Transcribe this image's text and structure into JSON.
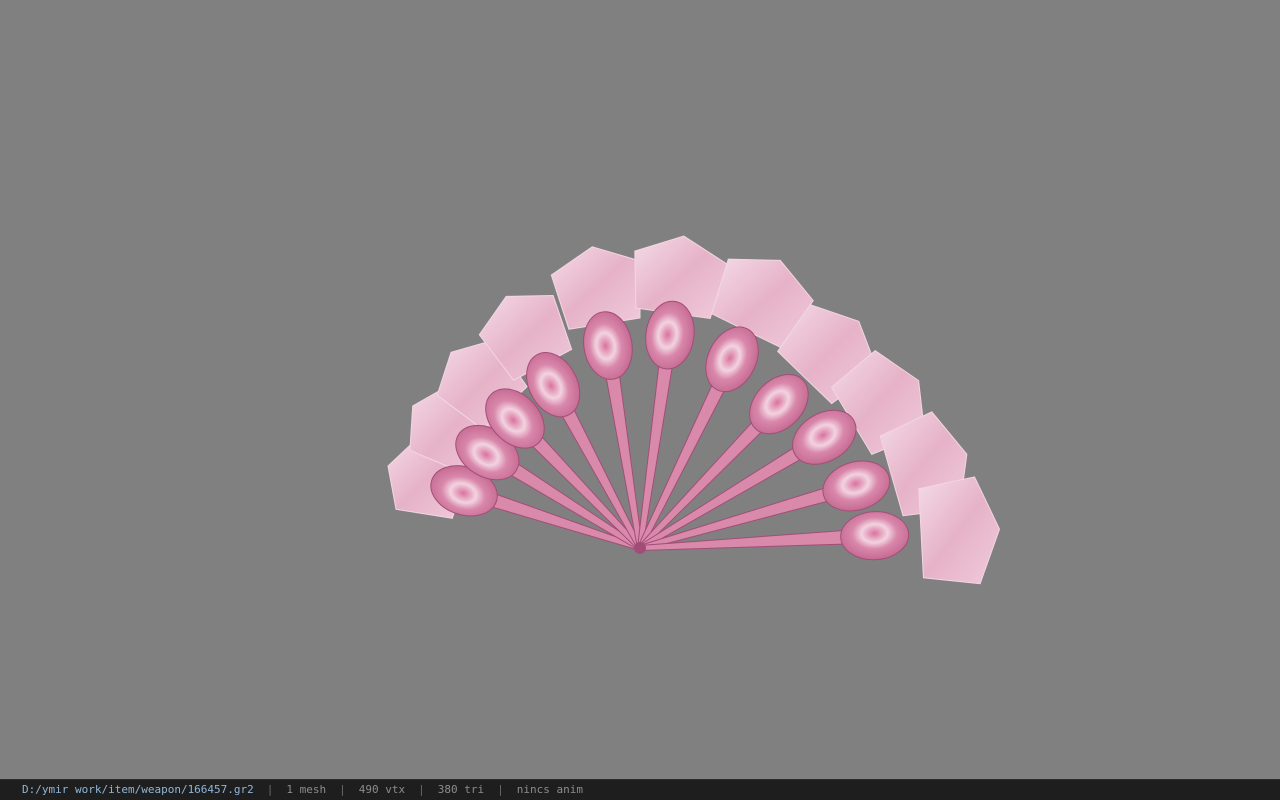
{
  "viewer": {
    "background_color": "#808080",
    "model": {
      "subject": "pink folding fan weapon model",
      "primary_color": "#d98aab",
      "highlight_color": "#f3d6e2",
      "shadow_color": "#a24d78"
    }
  },
  "statusbar": {
    "path": "D:/ymir work/item/weapon/166457.gr2",
    "sep": "|",
    "mesh": "1 mesh",
    "vertices": "490 vtx",
    "triangles": "380 tri",
    "anim": "nincs anim"
  }
}
